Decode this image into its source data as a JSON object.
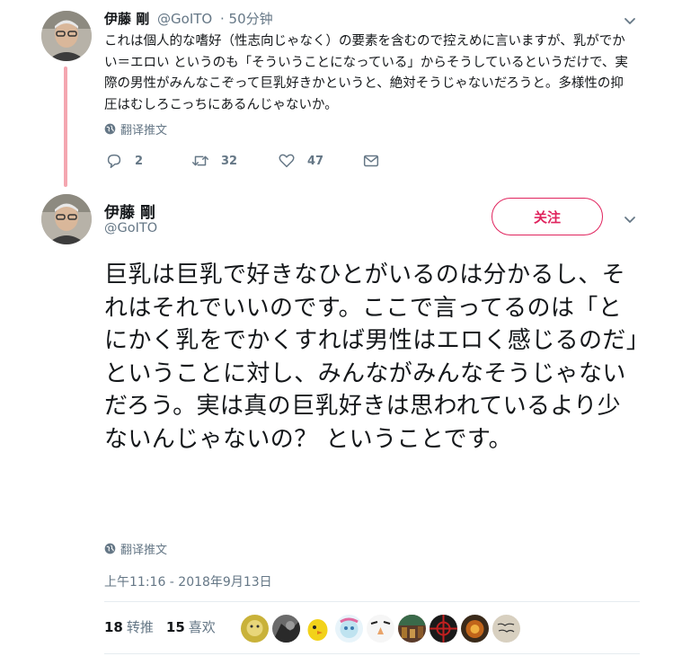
{
  "tweet1": {
    "name": "伊藤 剛",
    "handle": "@GoITO",
    "time": "· 50分钟",
    "text": "これは個人的な嗜好（性志向じゃなく）の要素を含むので控えめに言いますが、乳がでかい＝エロい というのも「そういうことになっている」からそうしているというだけで、実際の男性がみんなこぞって巨乳好きかというと、絶対そうじゃないだろうと。多様性の抑圧はむしろこっちにあるんじゃないか。",
    "translate_label": "翻译推文",
    "replies": "2",
    "retweets": "32",
    "likes": "47"
  },
  "tweet2": {
    "name": "伊藤 剛",
    "handle": "@GoITO",
    "follow_label": "关注",
    "text": "巨乳は巨乳で好きなひとがいるのは分かるし、それはそれでいいのです。ここで言ってるのは「とにかく乳をでかくすれば男性はエロく感じるのだ」ということに対し、みんながみんなそうじゃないだろう。実は真の巨乳好きは思われているより少ないんじゃないの？ ということです。",
    "translate_label": "翻译推文",
    "timestamp": "上午11:16 - 2018年9月13日",
    "retweet_count": "18",
    "retweet_label": "转推",
    "like_count": "15",
    "like_label": "喜欢"
  },
  "colors": {
    "accent_pink": "#e0245e",
    "thread_line": "#f4a6b0",
    "muted": "#657786",
    "text": "#14171a"
  },
  "icons": [
    "chevron-down-icon",
    "globe-icon",
    "reply-icon",
    "retweet-icon",
    "heart-icon",
    "mail-icon"
  ],
  "likers": [
    {
      "name": "liker-avatar-1",
      "bg": "#c9b23a"
    },
    {
      "name": "liker-avatar-2",
      "bg": "#4a4a4a"
    },
    {
      "name": "liker-avatar-3",
      "bg": "#f2d21a"
    },
    {
      "name": "liker-avatar-4",
      "bg": "#bfe3f0"
    },
    {
      "name": "liker-avatar-5",
      "bg": "#f3f3f3"
    },
    {
      "name": "liker-avatar-6",
      "bg": "#5a3b2a"
    },
    {
      "name": "liker-avatar-7",
      "bg": "#1a1a1a"
    },
    {
      "name": "liker-avatar-8",
      "bg": "#3a2a1a"
    },
    {
      "name": "liker-avatar-9",
      "bg": "#d8d0c0"
    }
  ]
}
